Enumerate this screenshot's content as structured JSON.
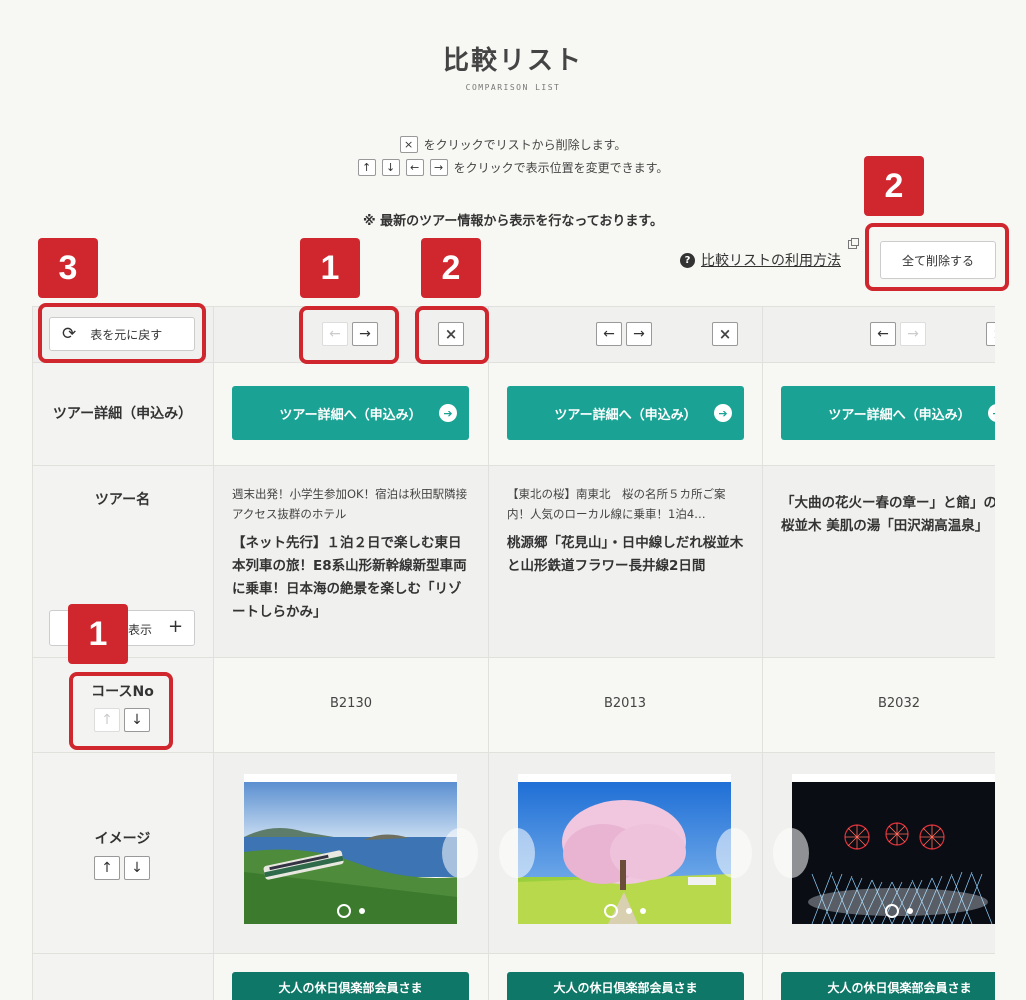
{
  "header": {
    "title": "比較リスト",
    "subtitle": "COMPARISON LIST",
    "instruction_delete": "をクリックでリストから削除します。",
    "instruction_move": "をクリックで表示位置を変更できます。",
    "notice": "※ 最新のツアー情報から表示を行なっております。"
  },
  "toolbar": {
    "help_label": "比較リストの利用方法",
    "delete_all_label": "全て削除する",
    "reset_label": "表を元に戻す"
  },
  "annotations": {
    "badge_1": "1",
    "badge_2": "2",
    "badge_3": "3",
    "color": "#d0262d"
  },
  "rows": {
    "detail_label": "ツアー詳細（申込み）",
    "name_label": "ツアー名",
    "show_label": "表示",
    "course_label": "コースNo",
    "image_label": "イメージ"
  },
  "tours": [
    {
      "detail_button": "ツアー詳細へ（申込み）",
      "sub_name": "週末出発！小学生参加OK！宿泊は秋田駅隣接 アクセス抜群のホテル",
      "main_name": "【ネット先行】１泊２日で楽しむ東日本列車の旅！E8系山形新幹線新型車両に乗車！日本海の絶景を楽しむ「リゾートしらかみ」",
      "course_no": "B2130",
      "member_label": "大人の休日倶楽部会員さま"
    },
    {
      "detail_button": "ツアー詳細へ（申込み）",
      "sub_name": "【東北の桜】南東北　桜の名所５カ所ご案内！人気のローカル線に乗車！1泊4…",
      "main_name": "桃源郷「花見山」・日中線しだれ桜並木と山形鉄道フラワー長井線2日間",
      "course_no": "B2013",
      "member_label": "大人の休日倶楽部会員さま"
    },
    {
      "detail_button": "ツアー詳細へ（申込み）",
      "sub_name": "",
      "main_name": "「大曲の花火ー春の章ー」と館」の桜並木 美肌の湯「田沢湖高温泉」",
      "course_no": "B2032",
      "member_label": "大人の休日倶楽部会員さま"
    }
  ],
  "icons": {
    "close": "×",
    "up": "↑",
    "down": "↓",
    "left": "←",
    "right": "→",
    "reset": "⟳",
    "plus": "+",
    "help": "?",
    "go": "➔"
  },
  "colors": {
    "accent_teal": "#1aa394",
    "member_green": "#0e7767",
    "background": "#f7f7f3"
  }
}
